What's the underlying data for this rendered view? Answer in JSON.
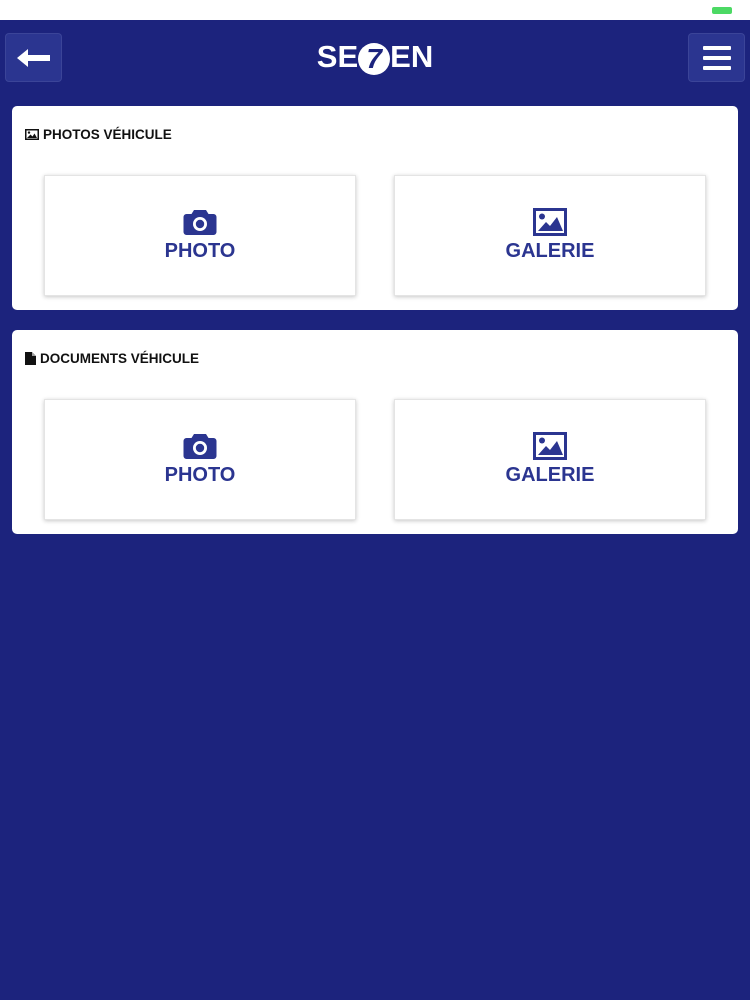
{
  "colors": {
    "background": "#1c237d",
    "accent": "#2b3590",
    "battery": "#4cd964",
    "nav_button": "#2b3590"
  },
  "header": {
    "back_icon": "arrow-left-icon",
    "logo_text_left": "SE",
    "logo_mark": "7",
    "logo_text_right": "EN",
    "menu_icon": "hamburger-menu-icon"
  },
  "sections": [
    {
      "title": "PHOTOS VÉHICULE",
      "title_icon": "image-icon",
      "actions": [
        {
          "label": "PHOTO",
          "icon": "camera-icon"
        },
        {
          "label": "GALERIE",
          "icon": "gallery-icon"
        }
      ]
    },
    {
      "title": "DOCUMENTS VÉHICULE",
      "title_icon": "document-icon",
      "actions": [
        {
          "label": "PHOTO",
          "icon": "camera-icon"
        },
        {
          "label": "GALERIE",
          "icon": "gallery-icon"
        }
      ]
    }
  ]
}
